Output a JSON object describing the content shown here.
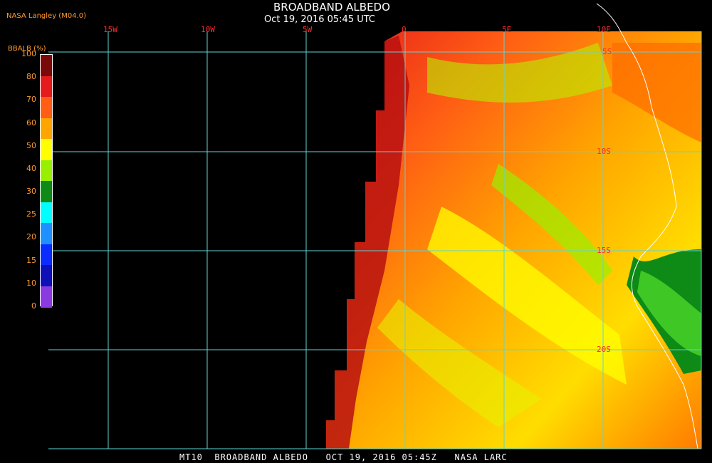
{
  "header": {
    "title": "BROADBAND ALBEDO",
    "subtitle": "Oct 19, 2016 05:45 UTC",
    "producer": "NASA Langley (M04.0)"
  },
  "colorbar": {
    "title": "BBALB (%)",
    "ticks": [
      "100",
      "80",
      "70",
      "60",
      "50",
      "40",
      "30",
      "25",
      "20",
      "15",
      "10",
      "0"
    ],
    "colors": [
      "#7a0a0a",
      "#e51b1b",
      "#ff5e14",
      "#ffa500",
      "#ffff00",
      "#98f000",
      "#0e8a16",
      "#00ffff",
      "#1e90ff",
      "#0a2cff",
      "#1010b8",
      "#8a3ae0"
    ]
  },
  "map": {
    "lon_labels": [
      "15W",
      "10W",
      "5W",
      "0",
      "5E",
      "10E"
    ],
    "lat_labels": [
      "5S",
      "10S",
      "15S",
      "20S"
    ],
    "grid_color": "#5fd3d3",
    "label_color": "#ff2a2a"
  },
  "footer": {
    "text": "MT10  BROADBAND ALBEDO   OCT 19, 2016 05:45Z   NASA LARC"
  }
}
